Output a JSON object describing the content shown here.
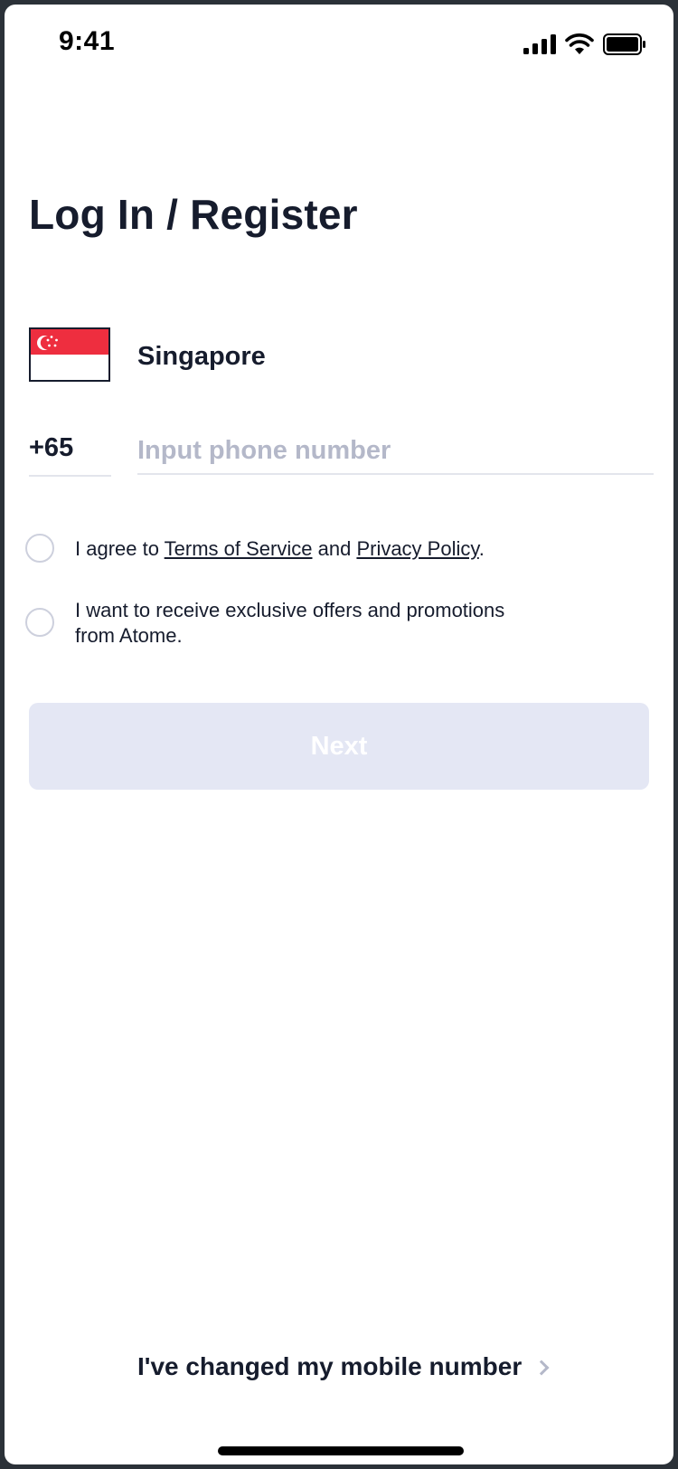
{
  "status_bar": {
    "time": "9:41"
  },
  "page": {
    "title": "Log In / Register"
  },
  "country": {
    "name": "Singapore",
    "flag": "singapore-flag",
    "colors": {
      "red": "#ee2e3f",
      "white": "#ffffff"
    }
  },
  "phone": {
    "dial_code": "+65",
    "value": "",
    "placeholder": "Input phone number"
  },
  "consent": {
    "terms": {
      "prefix": "I agree to ",
      "terms_link": "Terms of Service",
      "conjunction": " and ",
      "privacy_link": "Privacy Policy",
      "suffix": ".",
      "checked": false
    },
    "marketing": {
      "line1": "I want to receive exclusive offers and promotions",
      "line2": "from Atome.",
      "checked": false
    }
  },
  "actions": {
    "next_label": "Next",
    "changed_number_label": "I've changed my mobile number"
  },
  "theme": {
    "text": "#161c2d",
    "button_disabled": "#e4e7f4",
    "placeholder": "#b4b8c9"
  }
}
